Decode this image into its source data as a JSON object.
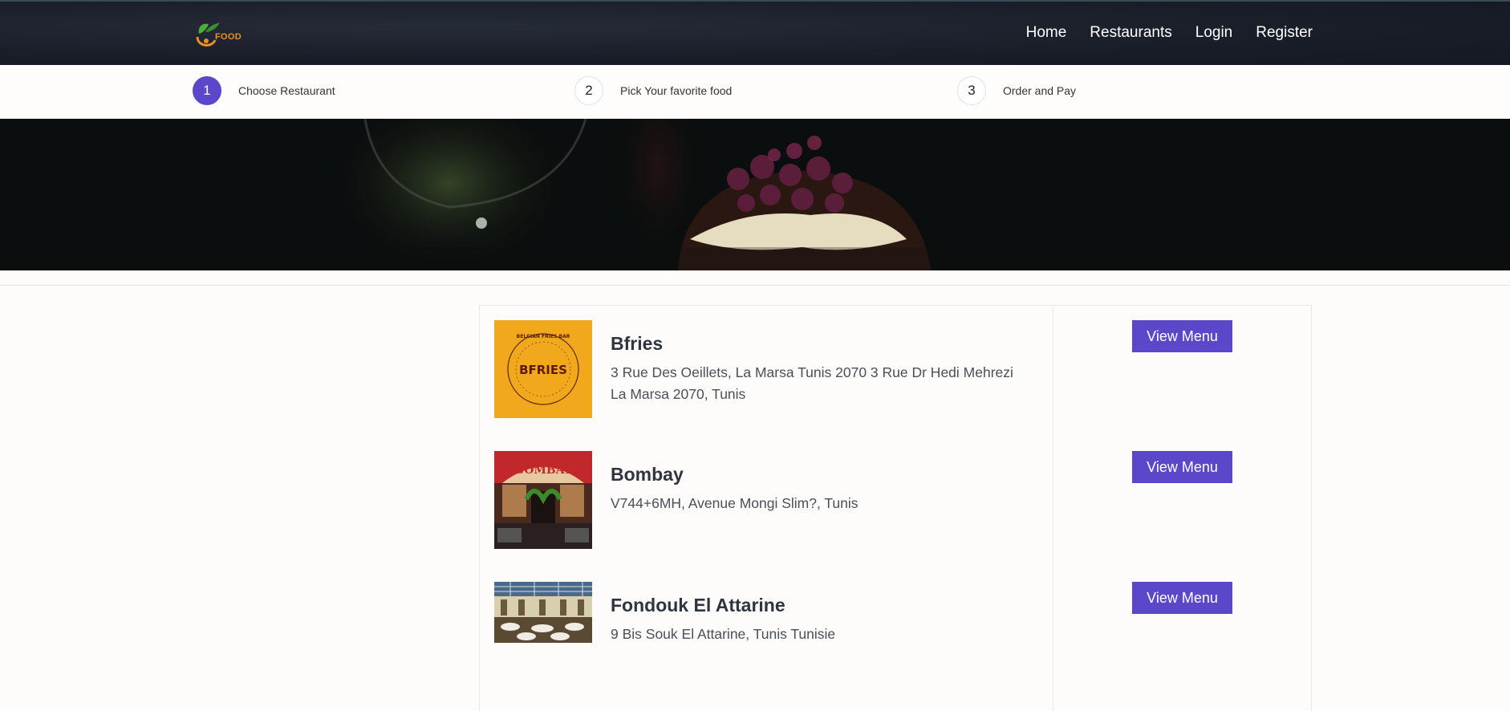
{
  "brand": {
    "logo_text": "FOOD"
  },
  "nav": {
    "items": [
      "Home",
      "Restaurants",
      "Login",
      "Register"
    ]
  },
  "steps": [
    {
      "number": "1",
      "label": "Choose Restaurant",
      "active": true
    },
    {
      "number": "2",
      "label": "Pick Your favorite food",
      "active": false
    },
    {
      "number": "3",
      "label": "Order and Pay",
      "active": false
    }
  ],
  "restaurants": [
    {
      "name": "Bfries",
      "address": "3 Rue Des Oeillets, La Marsa Tunis 2070 3 Rue Dr Hedi Mehrezi La Marsa 2070, Tunis",
      "logo_text": "BFRIES",
      "logo_ring_text": "BELGIAN FRIES BAR",
      "button_label": "View Menu"
    },
    {
      "name": "Bombay",
      "address": "V744+6MH, Avenue Mongi Slim?, Tunis",
      "logo_text": "BOMBAY",
      "button_label": "View Menu"
    },
    {
      "name": "Fondouk El Attarine",
      "address": "9 Bis Souk El Attarine, Tunis Tunisie",
      "button_label": "View Menu"
    }
  ],
  "colors": {
    "accent": "#5b47c9",
    "header_bg": "#1a1e29",
    "logo_orange": "#e8902a"
  }
}
